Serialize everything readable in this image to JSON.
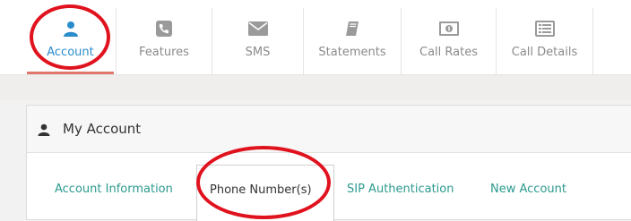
{
  "nav": {
    "items": [
      {
        "label": "Account",
        "icon": "user-icon",
        "active": true
      },
      {
        "label": "Features",
        "icon": "phone-icon",
        "active": false
      },
      {
        "label": "SMS",
        "icon": "envelope-icon",
        "active": false
      },
      {
        "label": "Statements",
        "icon": "book-icon",
        "active": false
      },
      {
        "label": "Call Rates",
        "icon": "money-icon",
        "active": false
      },
      {
        "label": "Call Details",
        "icon": "list-icon",
        "active": false
      }
    ]
  },
  "panel": {
    "title": "My Account",
    "title_icon": "user-icon",
    "tabs": [
      {
        "label": "Account Information",
        "active": false
      },
      {
        "label": "Phone Number(s)",
        "active": true
      },
      {
        "label": "SIP Authentication",
        "active": false
      },
      {
        "label": "New Account",
        "active": false
      }
    ]
  },
  "colors": {
    "accent": "#2b8ccc",
    "tab_link": "#2b9a8f",
    "active_underline": "#e0776a",
    "annotation": "#e0121e"
  }
}
